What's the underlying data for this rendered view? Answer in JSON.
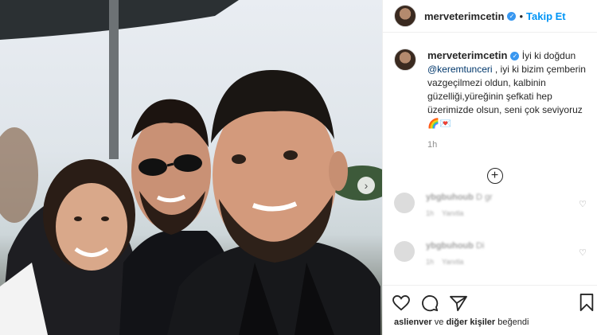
{
  "post": {
    "username": "merveterimcetin",
    "follow_label": "Takip Et",
    "caption_lines": [
      "İyi ki doğdun",
      "@keremtunceri",
      " , iyi ki bizim çemberin vazgeçilmezi oldun, kalbinin güzelliği,yüreğinin şefkati hep üzerimizde olsun, seni çok seviyoruz"
    ],
    "caption_emojis": [
      "rainbow-emoji",
      "envelope-emoji"
    ],
    "caption_time": "1h",
    "likes": {
      "first_user": "aslienver",
      "joiner": "ve",
      "others": "diğer kişiler",
      "suffix": "beğendi"
    }
  },
  "comments": [
    {
      "username": "ybgbuhoub",
      "text": "D gr",
      "time": "1h",
      "reply": "Yanıtla"
    },
    {
      "username": "ybgbuhoub",
      "text": "Di",
      "time": "1h",
      "reply": "Yanıtla"
    }
  ],
  "icons": {
    "next": "chevron-right-icon",
    "add_comments": "plus-circle-icon",
    "like": "heart-icon",
    "comment": "comment-icon",
    "share": "send-icon",
    "save": "bookmark-icon"
  },
  "colors": {
    "link": "#0095f6",
    "mention": "#00376b",
    "verified": "#3897f0"
  }
}
